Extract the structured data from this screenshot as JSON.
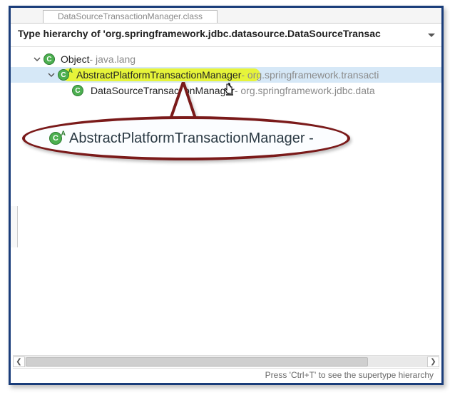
{
  "tab": {
    "label": "DataSourceTransactionManager.class"
  },
  "header": {
    "title": "Type hierarchy of 'org.springframework.jdbc.datasource.DataSourceTransac"
  },
  "tree": {
    "n0": {
      "name": "Object",
      "pkg": " - java.lang"
    },
    "n1": {
      "name": "AbstractPlatformTransactionManager",
      "pkg": " - org.springframework.transacti"
    },
    "n2": {
      "name": "DataSourceTransactionManager",
      "pkg": " - org.springframework.jdbc.data"
    }
  },
  "callout": {
    "text": "AbstractPlatformTransactionManager - "
  },
  "status": {
    "hint": "Press 'Ctrl+T' to see the supertype hierarchy"
  }
}
